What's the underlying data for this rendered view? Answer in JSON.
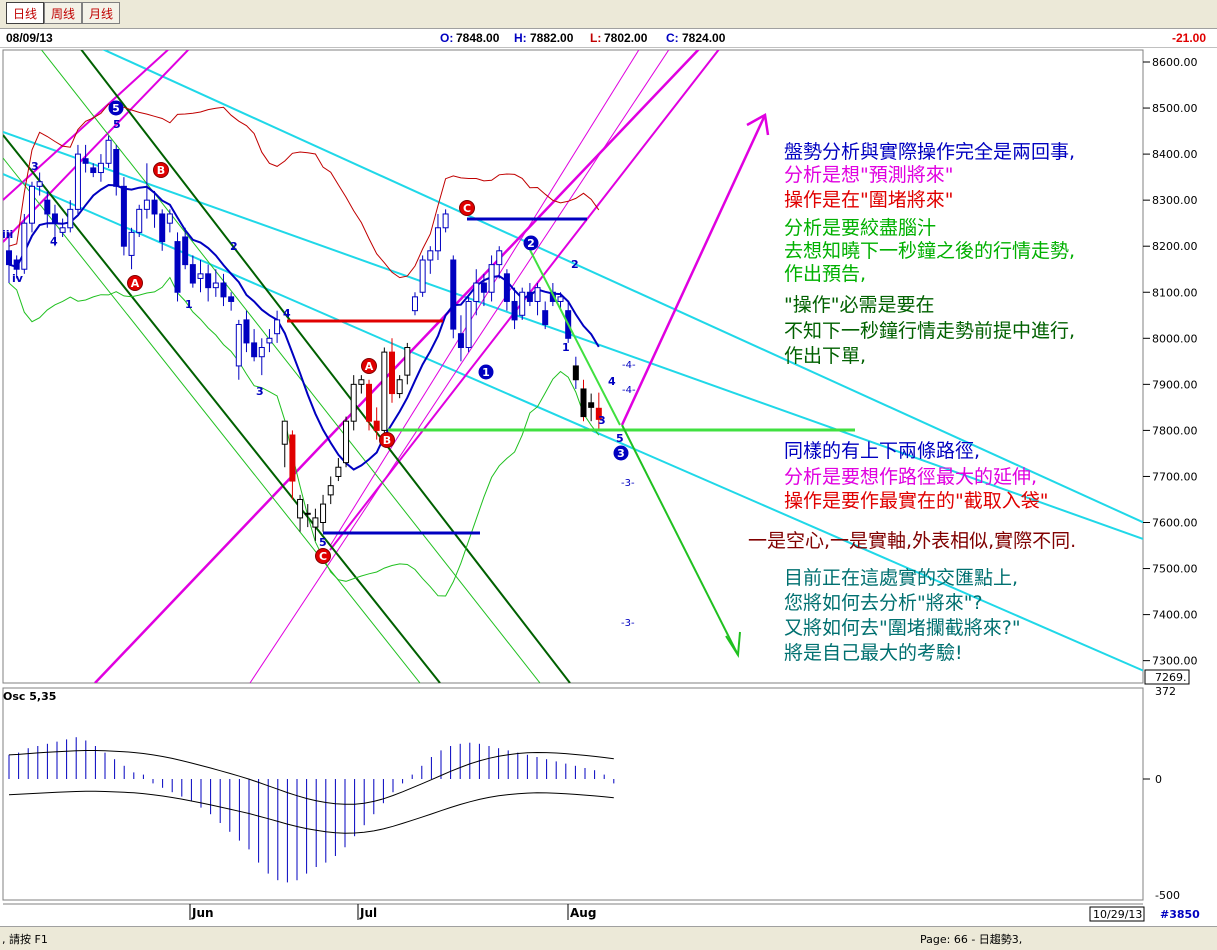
{
  "toolbar": {
    "tabs": [
      "日线",
      "周线",
      "月线"
    ]
  },
  "info": {
    "date": "08/09/13",
    "open_label": "O:",
    "open": "7848.00",
    "high_label": "H:",
    "high": "7882.00",
    "low_label": "L:",
    "low": "7802.00",
    "close_label": "C:",
    "close": "7824.00",
    "change": "-21.00"
  },
  "status": {
    "left": ", 請按 F1",
    "page": "Page: 66 - 日趨勢3,",
    "date_box": "10/29/13",
    "code": "#3850"
  },
  "osc": {
    "title": "Osc 5,35",
    "top_label": "372",
    "zero_label": "0",
    "bottom_label": "-500"
  },
  "colors": {
    "blue": "#0000c0",
    "magenta": "#e000e0",
    "red": "#e00000",
    "green": "#00b000",
    "darkgreen": "#006000",
    "cyan": "#20d8e8",
    "teal": "#007070",
    "darkred": "#800000"
  },
  "annotations": [
    {
      "text": "盤勢分析與實際操作完全是兩回事,",
      "color": "#0000c0"
    },
    {
      "text": "分析是想\"預測將來\"",
      "color": "#e000e0"
    },
    {
      "text": "操作是在\"圍堵將來\"",
      "color": "#e00000"
    },
    {
      "text": "分析是要絞盡腦汁",
      "color": "#00b000"
    },
    {
      "text": "去想知曉下一秒鐘之後的行情走勢,",
      "color": "#00b000"
    },
    {
      "text": "作出預告,",
      "color": "#00b000"
    },
    {
      "text": "\"操作\"必需是要在",
      "color": "#006000"
    },
    {
      "text": "不知下一秒鐘行情走勢前提中進行,",
      "color": "#006000"
    },
    {
      "text": "作出下單,",
      "color": "#006000"
    },
    {
      "text": "同樣的有上下兩條路徑,",
      "color": "#0000c0"
    },
    {
      "text": "分析是要想作路徑最大的延伸,",
      "color": "#e000e0"
    },
    {
      "text": "操作是要作最實在的\"截取入袋\"",
      "color": "#e00000"
    },
    {
      "text": "一是空心,一是實軸,外表相似,實際不同.",
      "color": "#800000"
    },
    {
      "text": "目前正在這處實的交匯點上,",
      "color": "#007070"
    },
    {
      "text": "您將如何去分析\"將來\"?",
      "color": "#007070"
    },
    {
      "text": "又將如何去\"圍堵攔截將來?\"",
      "color": "#007070"
    },
    {
      "text": "將是自己最大的考驗!",
      "color": "#007070"
    }
  ],
  "chart_data": [
    {
      "type": "candlestick",
      "price_axis": {
        "ticks": [
          "8600.00",
          "8500.00",
          "8400.00",
          "8300.00",
          "8200.00",
          "8100.00",
          "8000.00",
          "7900.00",
          "7800.00",
          "7700.00",
          "7600.00",
          "7500.00",
          "7400.00",
          "7300.00"
        ],
        "last": "7269.",
        "range": [
          7260,
          8620
        ]
      },
      "time_axis": {
        "labels": [
          "Jun",
          "Jul",
          "Aug"
        ]
      },
      "candles": [
        [
          8190,
          8230,
          8120,
          8160
        ],
        [
          8170,
          8180,
          8130,
          8150
        ],
        [
          8150,
          8270,
          8140,
          8250
        ],
        [
          8250,
          8340,
          8230,
          8330
        ],
        [
          8330,
          8360,
          8310,
          8340
        ],
        [
          8300,
          8320,
          8240,
          8270
        ],
        [
          8270,
          8290,
          8200,
          8250
        ],
        [
          8230,
          8260,
          8220,
          8240
        ],
        [
          8240,
          8300,
          8230,
          8280
        ],
        [
          8280,
          8420,
          8270,
          8400
        ],
        [
          8390,
          8420,
          8360,
          8380
        ],
        [
          8370,
          8380,
          8350,
          8360
        ],
        [
          8360,
          8400,
          8340,
          8380
        ],
        [
          8380,
          8440,
          8370,
          8430
        ],
        [
          8410,
          8420,
          8310,
          8330
        ],
        [
          8330,
          8350,
          8180,
          8200
        ],
        [
          8180,
          8240,
          8150,
          8230
        ],
        [
          8230,
          8290,
          8220,
          8280
        ],
        [
          8280,
          8380,
          8260,
          8300
        ],
        [
          8300,
          8320,
          8240,
          8270
        ],
        [
          8270,
          8280,
          8190,
          8210
        ],
        [
          8250,
          8280,
          8230,
          8270
        ],
        [
          8210,
          8230,
          8080,
          8100
        ],
        [
          8220,
          8240,
          8150,
          8160
        ],
        [
          8160,
          8180,
          8110,
          8120
        ],
        [
          8130,
          8170,
          8100,
          8140
        ],
        [
          8140,
          8160,
          8080,
          8110
        ],
        [
          8110,
          8150,
          8090,
          8120
        ],
        [
          8120,
          8140,
          8070,
          8090
        ],
        [
          8090,
          8100,
          8060,
          8080
        ],
        [
          7940,
          8040,
          7910,
          8030
        ],
        [
          8040,
          8060,
          7970,
          7990
        ],
        [
          7990,
          8020,
          7950,
          7960
        ],
        [
          7960,
          8000,
          7920,
          7980
        ],
        [
          7990,
          8020,
          7970,
          8000
        ],
        [
          8010,
          8060,
          7990,
          8040
        ],
        [
          7770,
          7820,
          7720,
          7820
        ],
        [
          7790,
          7800,
          7650,
          7690
        ],
        [
          7610,
          7660,
          7580,
          7650
        ],
        [
          7620,
          7640,
          7590,
          7620
        ],
        [
          7590,
          7630,
          7560,
          7610
        ],
        [
          7600,
          7660,
          7580,
          7640
        ],
        [
          7660,
          7700,
          7640,
          7680
        ],
        [
          7700,
          7740,
          7690,
          7720
        ],
        [
          7730,
          7830,
          7720,
          7820
        ],
        [
          7820,
          7920,
          7800,
          7900
        ],
        [
          7900,
          7920,
          7880,
          7910
        ],
        [
          7900,
          7910,
          7800,
          7820
        ],
        [
          7820,
          7850,
          7780,
          7800
        ],
        [
          7800,
          7980,
          7790,
          7970
        ],
        [
          7970,
          8000,
          7860,
          7880
        ],
        [
          7880,
          7920,
          7870,
          7910
        ],
        [
          7920,
          7990,
          7900,
          7980
        ],
        [
          8060,
          8100,
          8050,
          8090
        ],
        [
          8100,
          8180,
          8090,
          8170
        ],
        [
          8170,
          8200,
          8140,
          8190
        ],
        [
          8190,
          8270,
          8170,
          8240
        ],
        [
          8240,
          8280,
          8230,
          8270
        ],
        [
          8170,
          8180,
          8000,
          8020
        ],
        [
          8010,
          8050,
          7950,
          7980
        ],
        [
          7980,
          8090,
          7970,
          8080
        ],
        [
          8080,
          8150,
          8050,
          8120
        ],
        [
          8120,
          8140,
          8070,
          8100
        ],
        [
          8100,
          8180,
          8080,
          8160
        ],
        [
          8160,
          8200,
          8130,
          8190
        ],
        [
          8140,
          8150,
          8060,
          8080
        ],
        [
          8080,
          8110,
          8020,
          8040
        ],
        [
          8050,
          8110,
          8040,
          8100
        ],
        [
          8100,
          8120,
          8070,
          8080
        ],
        [
          8080,
          8120,
          8050,
          8110
        ],
        [
          8060,
          8080,
          8020,
          8030
        ],
        [
          8100,
          8120,
          8070,
          8080
        ],
        [
          8080,
          8100,
          8060,
          8090
        ],
        [
          8060,
          8080,
          7990,
          8000
        ],
        [
          7940,
          7960,
          7890,
          7910
        ],
        [
          7890,
          7910,
          7820,
          7830
        ],
        [
          7850,
          7880,
          7820,
          7860
        ],
        [
          7848,
          7882,
          7802,
          7824
        ]
      ],
      "wave_labels": [
        "iii",
        "iv",
        "3",
        "4",
        "5",
        "1",
        "2",
        "3",
        "4",
        "5",
        "1",
        "2",
        "3",
        "4",
        "5",
        "2",
        "1",
        "2",
        "3",
        "4",
        "5",
        "-4-",
        "-4-",
        "-3-",
        "-3-"
      ],
      "wave_markers": [
        "5",
        "B",
        "A",
        "A",
        "B",
        "C",
        "C",
        "1",
        "2",
        "3"
      ]
    },
    {
      "type": "bar",
      "title": "Osc 5,35",
      "y_labels": [
        "372",
        "0",
        "-500"
      ],
      "values": [
        110,
        120,
        140,
        150,
        160,
        170,
        180,
        190,
        175,
        150,
        120,
        90,
        60,
        30,
        20,
        -20,
        -40,
        -60,
        -80,
        -100,
        -130,
        -160,
        -200,
        -240,
        -280,
        -320,
        -380,
        -430,
        -460,
        -470,
        -460,
        -430,
        -400,
        -380,
        -350,
        -310,
        -260,
        -210,
        -160,
        -110,
        -60,
        -20,
        20,
        60,
        100,
        130,
        150,
        160,
        165,
        160,
        150,
        140,
        130,
        120,
        110,
        100,
        90,
        80,
        70,
        60,
        50,
        40,
        20,
        -20
      ]
    }
  ]
}
